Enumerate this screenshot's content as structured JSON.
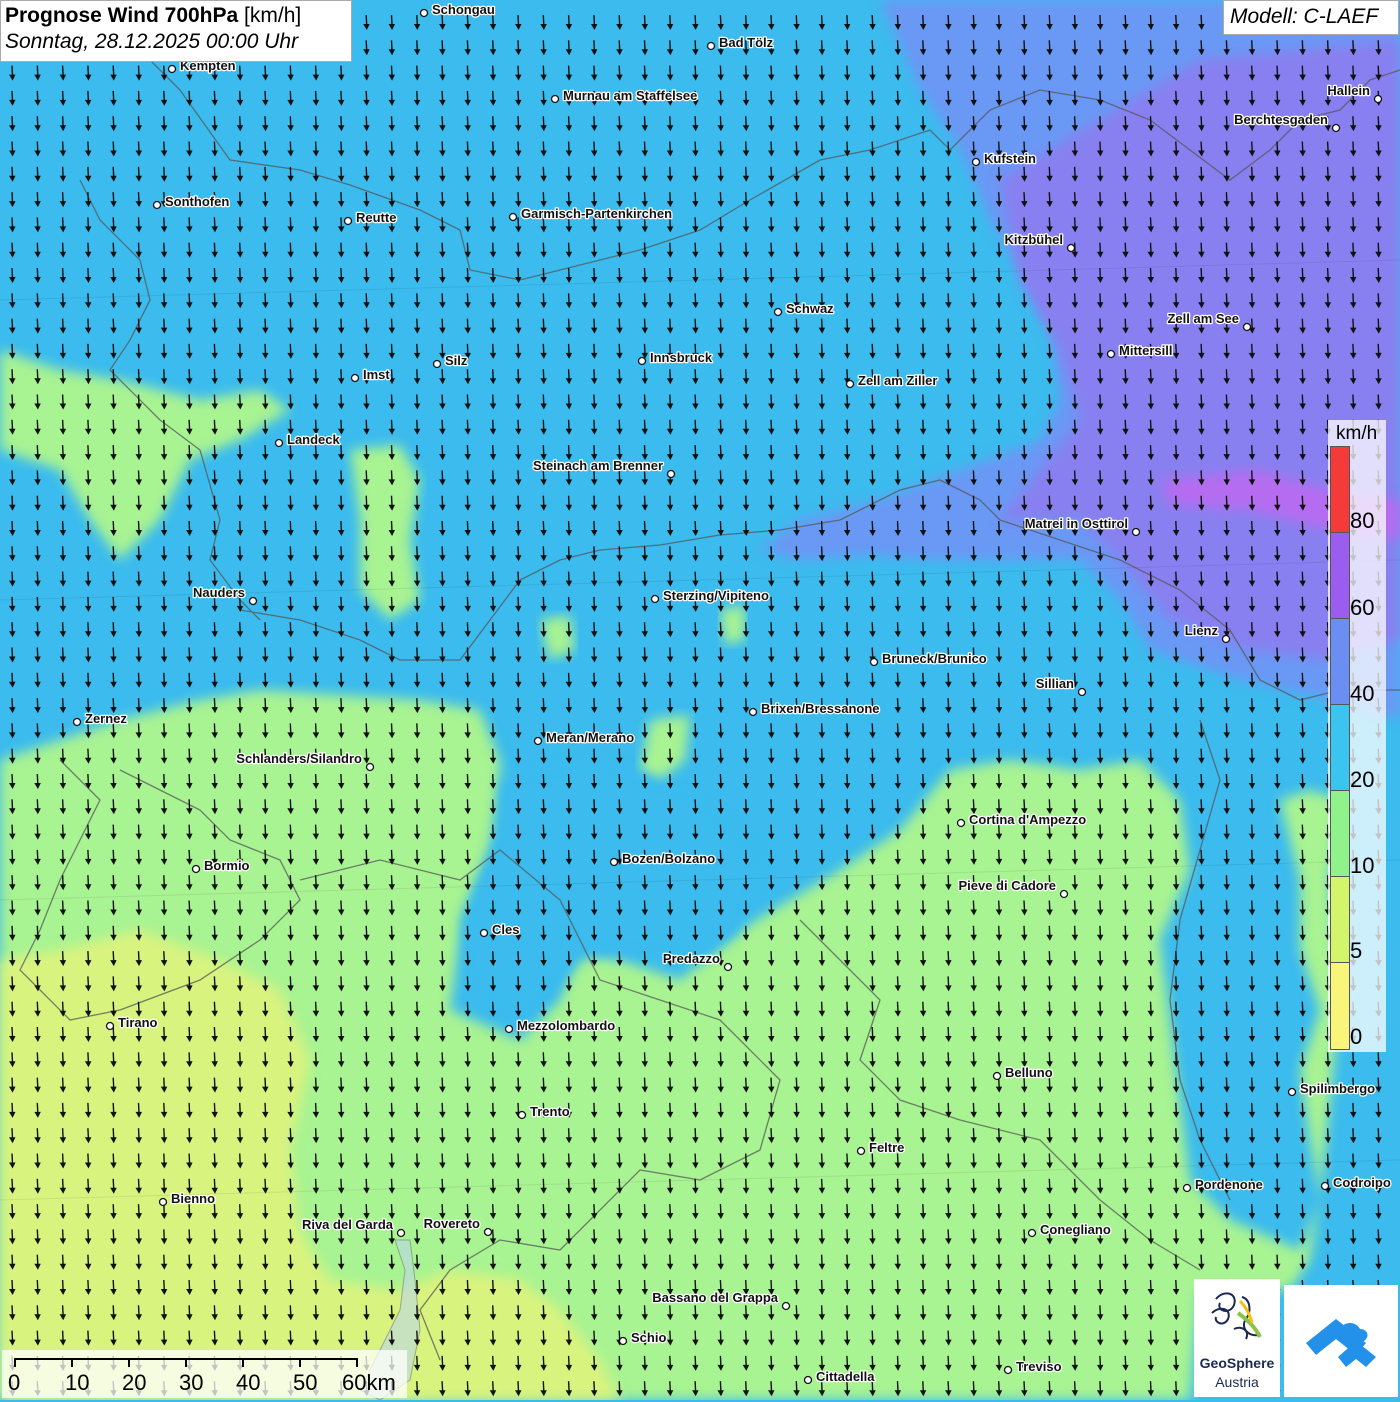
{
  "header": {
    "title_bold": "Prognose Wind 700hPa",
    "title_unit": "[km/h]",
    "datetime": "Sonntag, 28.12.2025 00:00 Uhr",
    "model": "Modell: C-LAEF"
  },
  "legend": {
    "unit": "km/h",
    "ticks": [
      "80",
      "60",
      "40",
      "20",
      "10",
      "5",
      "0"
    ],
    "colors_top_to_bottom": [
      "#f53a3a",
      "#9b5cf0",
      "#6b8ef2",
      "#3cc4f0",
      "#8ff28a",
      "#d2f56b",
      "#f8f57a"
    ]
  },
  "scalebar": {
    "labels": [
      "0",
      "10",
      "20",
      "30",
      "40",
      "50",
      "60km"
    ]
  },
  "map_layers": {
    "wind_arrow_direction": "south",
    "colors": {
      "under_5": "#d9f37f",
      "5_10": "#a8f392",
      "10_20": "#3bbbee",
      "20_40": "#6a98f5",
      "40_60": "#8f7ff0",
      "60_80": "#b56cf0"
    }
  },
  "cities": [
    {
      "name": "Schongau"
    },
    {
      "name": "Bad Tölz"
    },
    {
      "name": "Kempten"
    },
    {
      "name": "Murnau am Staffelsee"
    },
    {
      "name": "Hallein"
    },
    {
      "name": "Berchtesgaden"
    },
    {
      "name": "Kufstein"
    },
    {
      "name": "Sonthofen"
    },
    {
      "name": "Reutte"
    },
    {
      "name": "Garmisch-Partenkirchen"
    },
    {
      "name": "Kitzbühel"
    },
    {
      "name": "Schwaz"
    },
    {
      "name": "Zell am See"
    },
    {
      "name": "Mittersill"
    },
    {
      "name": "Innsbruck"
    },
    {
      "name": "Silz"
    },
    {
      "name": "Imst"
    },
    {
      "name": "Zell am Ziller"
    },
    {
      "name": "Landeck"
    },
    {
      "name": "Steinach am Brenner"
    },
    {
      "name": "Matrei in Osttirol"
    },
    {
      "name": "Nauders"
    },
    {
      "name": "Sterzing/Vipiteno"
    },
    {
      "name": "Lienz"
    },
    {
      "name": "Bruneck/Brunico"
    },
    {
      "name": "Sillian"
    },
    {
      "name": "Brixen/Bressanone"
    },
    {
      "name": "Zernez"
    },
    {
      "name": "Meran/Merano"
    },
    {
      "name": "Schlanders/Silandro"
    },
    {
      "name": "Cortina d'Ampezzo"
    },
    {
      "name": "Bormio"
    },
    {
      "name": "Bozen/Bolzano"
    },
    {
      "name": "Pieve di Cadore"
    },
    {
      "name": "Cles"
    },
    {
      "name": "Predazzo"
    },
    {
      "name": "Tirano"
    },
    {
      "name": "Mezzolombardo"
    },
    {
      "name": "Belluno"
    },
    {
      "name": "Spilimbergo"
    },
    {
      "name": "Trento"
    },
    {
      "name": "Feltre"
    },
    {
      "name": "Pordenone"
    },
    {
      "name": "Codroipo"
    },
    {
      "name": "Bienno"
    },
    {
      "name": "Riva del Garda"
    },
    {
      "name": "Rovereto"
    },
    {
      "name": "Conegliano"
    },
    {
      "name": "Bassano del Grappa"
    },
    {
      "name": "Schio"
    },
    {
      "name": "Treviso"
    },
    {
      "name": "Cittadella"
    }
  ],
  "logos": {
    "geosphere_line1": "GeoSphere",
    "geosphere_line2": "Austria"
  }
}
